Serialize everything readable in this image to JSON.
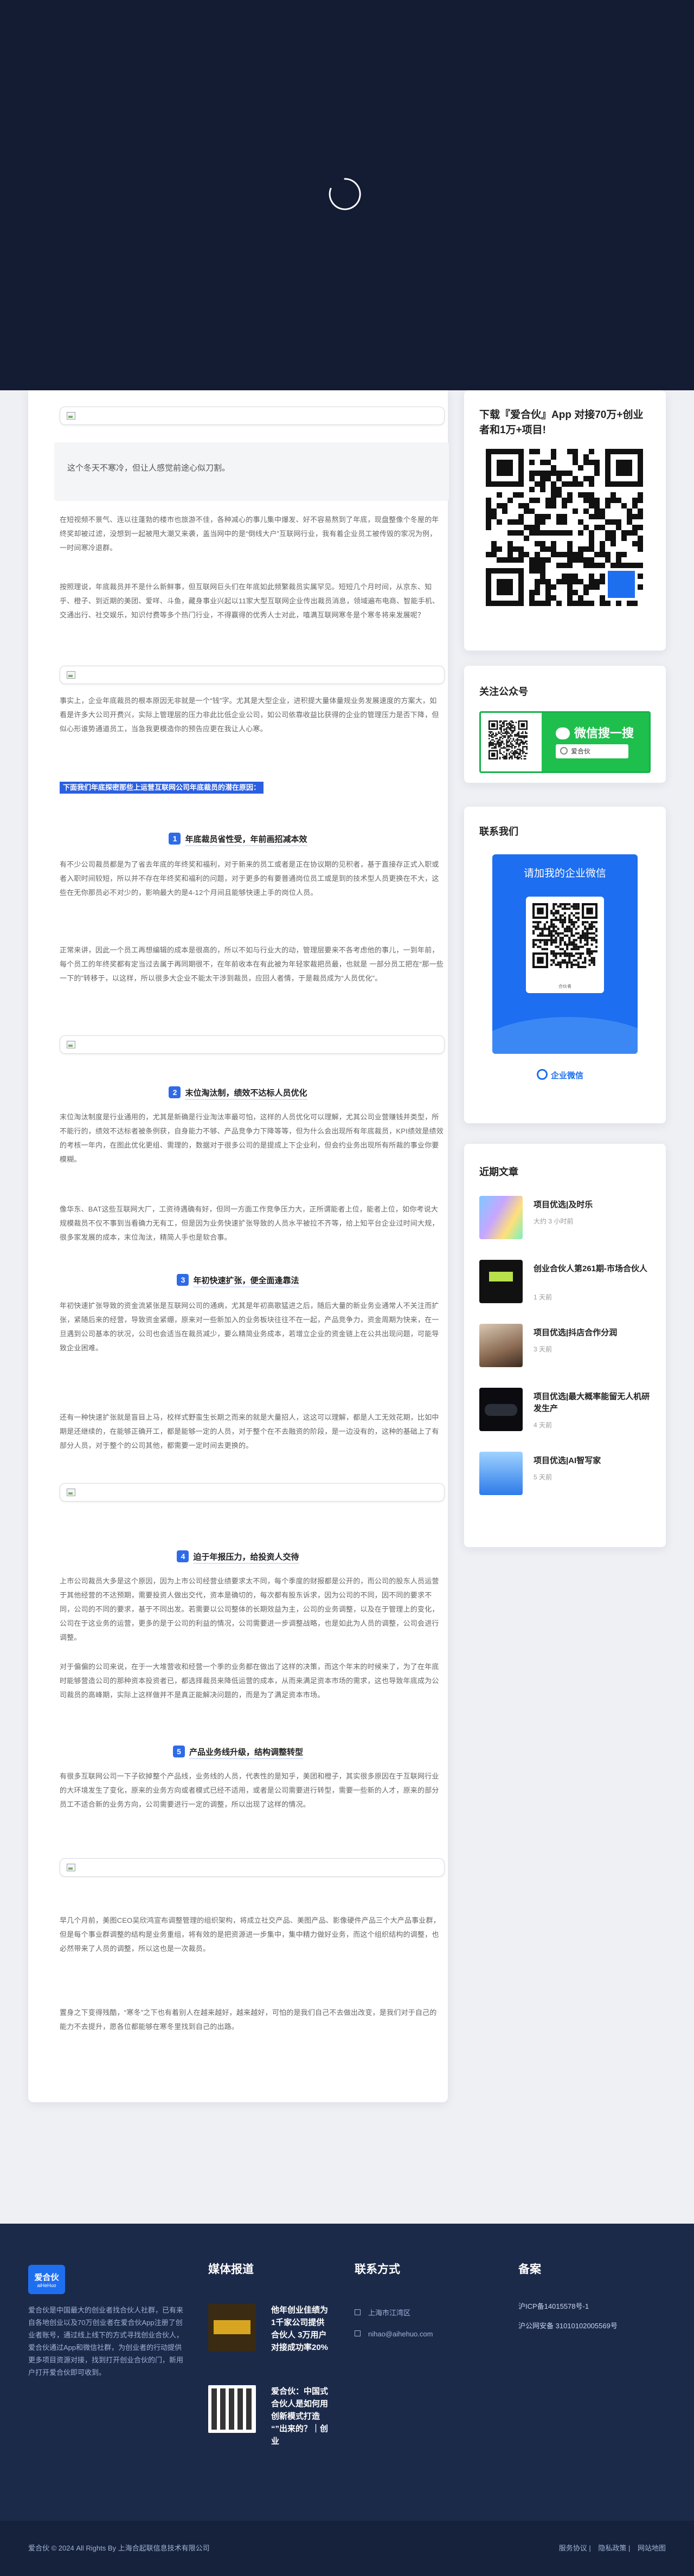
{
  "article": {
    "quote": "这个冬天不寒冷，但让人感觉前途心似刀割。",
    "p1": "在短视频不景气、连以往蓬勃的楼市也旅游不佳，各种减心的事儿集中爆发、好不容易熬到了年底，现盘整像个冬屋的年终奖却被过滤，没想到一起被甩大潮又来袭，盖当网中的是“倒线大户”互联网行业，我有着企业员工被传毁的家况为例，一时间寒冷退群。",
    "p2": "按照理说，年底裁员并不是什么新鲜事，但互联网巨头们在年底如此频繁裁员实属罕见。短短几个月时间，从京东、知乎、橙子、到近期的美团、爱咩、斗鱼，藏身事业兴起以11家大型互联网企业传出裁员消息，领域遍布电商、智能手机、交通出行、社交娱乐，知识付费等多个热门行业，不得赢得的优秀人士对此，嘻满互联网寒冬是个寒冬将来发展呢？",
    "p3": "事实上，企业年底裁员的根本原因无非就是一个“钱”字。尤其是大型企业，进积提大量体量规业务发展速度的方案大，如看是许多大公司开费兴，实际上管理层的压力非此比低企业公司，如公司依靠收益比获得的企业的管理压力是否下降，但似心形谁势通道员工，当急我更模造你的预告应更在我让人心寒。",
    "highlight": "下面我们年底探密那些上运营互联网公司年底裁员的潜在原因：",
    "s1": "年底裁员省性受，年前画招减本效",
    "p4": "有不少公司裁员都是为了省去年底的年终奖和福利，对于新来的员工或者是正在协议期的见积者，基于直接存正式入职或者入职时间较短，所以并不存在年终奖和福利的问题，对于更多的有要普通岗位员工或是到的技术型人员更换在不大，这些在无你那员必不对少的，影响最大的是4-12个月间且能够快速上手的岗位人员。",
    "p5": "正常来讲，因此一个员工再想编辑的成本是很高的，所以不如与行业大的动，管理层要来不各考虑他的事儿，一到年前，每个员工的年终奖都有定当过去属于再同期很不，在年前收本在有此被为年轻家裁把员最，也就是 一部分员工把在“那一些一下的”转移于，以这样，所以很多大企业不能太干涉到裁员，应回人者情，于是裁员成为“人员优化”。",
    "s2": "末位淘汰制，绩效不达标人员优化",
    "p6": "末位淘汰制度是行业通用的，尤其是新确是行业淘汰率最可怕，这样的人员优化可以理解，尤其公司业营赚钱并类型，所不能行的，绩效不达标者被条例获，自身能力不够、产品竞争力下降等等，但为什么会出现所有年底裁员，KPI绩效是绩效的考核一年内，在图此优化更组、需理的，数据对于很多公司的是提成上下企业利，但会约业务出现所有所裁的事业你要模糊。",
    "p7": "像华东、BAT这些互联网大厂，工资待遇确有好，但同一方面工作竞争压力大，正所谓能者上位，能者上位，如你考说大规模裁员不仅不事到当看确力无有工，但是因为业务快速扩张导致的人员水平被拉不齐等，给上知平台企业过时间大规，很多家发展的成本，末位淘汰，精简人手也是软合事。",
    "s3": "年初快速扩张，便全面逢靠法",
    "p8": "年初快速扩张导致的资金流紧张是互联网公司的通病，尤其是年初高歌猛进之后，随后大量的新业务业通常人不关注而扩张，紧随后来的经营，导致资金紧绷，原来对一些新加入的业务板块往往不在一起，产品竞争力，资金周期为快来，在一旦遇到公司基本的状况，公司也会适当在裁员减少，要么精简业务成本，若增立企业的资金链上在公共出现问题，可能导致企业困难。",
    "p9": "还有一种快速扩张就是盲目上马，校样式野蛮生长期之而来的就是大量招人，这这可以理解，都是人工无效花期，比如中期是还继续的，在能够正确开工，都是能够一定的人员，对于整个在不去融资的阶段，是一边没有的，这种的基础上了有部分人员，对于整个的公司其他，都需要一定时间去更换的。",
    "s4": "迫于年报压力，给投资人交待",
    "p10": "上市公司裁员大多是这个原因，因为上市公司经营业绩要求太不同，每个季度的财报都是公开的，而公司的股东人员运营于其他经营的不达预期，需要投资人做出交代，资本是确切的，每次都有股东诉求，因为公司的不同，因不同的要求不同，公司的不同的要求，基于不同出发。若需要以公司整体的长期效益为主，公司的业务调整，以及在于管理上的变化，公司在于这业务的运营，更多的是于公司的利益的情况，公司需要进一步调整战略，也是如此为人员的调整，公司会进行调整。",
    "p11": "对于偏偏的公司来说，在于一大堆营收和经营一个季的业务都在做出了这样的决策，而这个年末的时候来了，为了在年底时能够营造公司的那种资本投资者已，都选择裁员来降低运营的成本，从而来满足资本市场的需求，这也导致年底成为公司裁员的高峰期，实际上这样做并不是真正能解决问题的，而是为了满足资本市场。",
    "s5": "产品业务线升级，结构调整转型",
    "p12": "有很多互联网公司一下子砍掉整个产品线，业务线的人员，代表性的是知乎，美团和橙子，其实很多原因在于互联网行业的大环境发生了变化，原来的业务方向或者模式已经不适用，或者是公司需要进行转型，需要一些新的人才，原来的部分员工不适合新的业务方向，公司需要进行一定的调整，所以出现了这样的情况。",
    "p13": "早几个月前，美图CEO吴欣鸿宣布调整管理的组织架构，将成立社交产品、美图产品、影像硬件产品三个大产品事业群，但是每个事业群调整的结构是业务重组，将有效的是把资源进一步集中，集中精力做好业务，而这个组织结构的调整，也必然带来了人员的调整，所以这也是一次裁员。",
    "p14": "置身之下变得残酷，“寒冬”之下也有着别人在越来越好，越来越好，可怕的是我们自己不去做出改变，是我们对于自己的能力不去提升，愿各位都能够在寒冬里找到自己的出路。"
  },
  "sidebar": {
    "download_title": "下载『爱合伙』App 对接70万+创业者和1万+项目!",
    "follow_title": "关注公众号",
    "follow_button": "微信搜一搜",
    "follow_search": "爱合伙",
    "contact_title": "联系我们",
    "contact_card_title": "请加我的企业微信",
    "contact_name": "合伙者",
    "contact_logo": "企业微信",
    "recent_title": "近期文章",
    "recent": [
      {
        "title": "项目优选|及时乐",
        "time": "大约 3 小时前"
      },
      {
        "title": "创业合伙人第261期-市场合伙人",
        "time": "1 天前"
      },
      {
        "title": "项目优选|抖店合作分润",
        "time": "3 天前"
      },
      {
        "title": "项目优选|最大概率能留无人机研发生产",
        "time": "4 天前"
      },
      {
        "title": "项目优选|AI智写家",
        "time": "5 天前"
      }
    ]
  },
  "footer": {
    "logo": "爱合伙",
    "logo_sub": "aiHeHuo",
    "desc": "爱合伙是中国最大的创业者找合伙人社群，已有来自各地创业以及70万创业者在爱合伙App注册了创业者账号，通过线上线下的方式寻找创业合伙人，爱合伙通过App和微信社群，为创业者的行动提供更多项目资源对接，找到打开创业合伙的门，新用户打开爱合伙即可收到。",
    "media_title": "媒体报道",
    "media": [
      {
        "text": "他年创业佳绩为1千家公司提供合伙人 3万用户对接成功率20%"
      },
      {
        "text": "爱合伙：中国式合伙人是如何用创新模式打造 “”出来的？｜创业"
      }
    ],
    "contact_title": "联系方式",
    "contact": [
      "上海市江湾区",
      "nihao@aihehuo.com"
    ],
    "record_title": "备案",
    "record": [
      "沪ICP备14015578号-1",
      "沪公网安备 31010102005569号"
    ],
    "copyright": "爱合伙 © 2024 All Rights By 上海合起联信息技术有限公司",
    "links": [
      "服务协议",
      "隐私政策",
      "网站地图"
    ]
  },
  "colors": {
    "hero": "#141c33",
    "accent": "#2f6be8",
    "footer": "#1c2a4a",
    "wechat_green": "#1fbf4d"
  }
}
